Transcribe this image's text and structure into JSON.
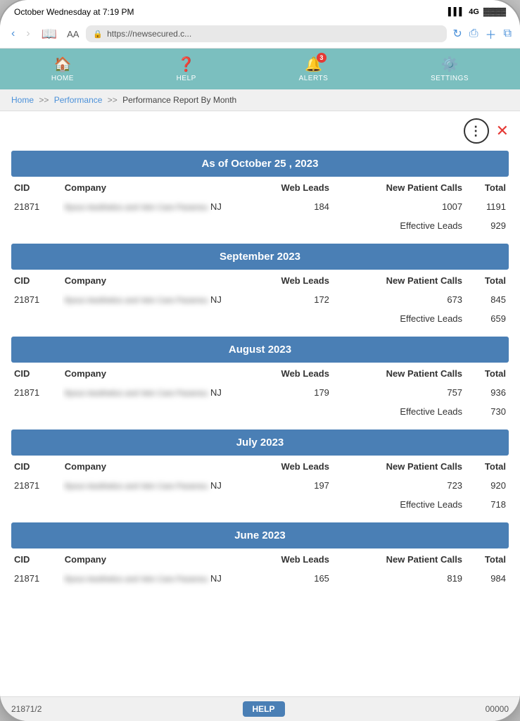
{
  "device": {
    "status_bar": {
      "time": "October Wednesday at 7:19 PM",
      "signal": "4G",
      "battery": "█"
    }
  },
  "browser": {
    "url": "https://newsecured.c...",
    "aa_label": "AA",
    "back_enabled": true,
    "forward_enabled": false
  },
  "nav": {
    "home_label": "HOME",
    "help_label": "HELP",
    "alerts_label": "ALERTS",
    "alerts_badge": "3",
    "settings_label": "SETTINGS"
  },
  "breadcrumb": {
    "home": "Home",
    "performance": "Performance",
    "current": "Performance Report By Month"
  },
  "sections": [
    {
      "id": "oct2023",
      "header": "As of October 25 , 2023",
      "rows": [
        {
          "cid": "21871",
          "company": "Ifyoun Aesthetics and Vein Care Paramou",
          "state": "NJ",
          "web_leads": "184",
          "new_patient_calls": "1007",
          "total": "1191"
        }
      ],
      "effective_leads": "929"
    },
    {
      "id": "sep2023",
      "header": "September 2023",
      "rows": [
        {
          "cid": "21871",
          "company": "Ifyoun Aesthetics and Vein Care Paramou",
          "state": "NJ",
          "web_leads": "172",
          "new_patient_calls": "673",
          "total": "845"
        }
      ],
      "effective_leads": "659"
    },
    {
      "id": "aug2023",
      "header": "August 2023",
      "rows": [
        {
          "cid": "21871",
          "company": "Ifyoun Aesthetics and Vein Care Paramou",
          "state": "NJ",
          "web_leads": "179",
          "new_patient_calls": "757",
          "total": "936"
        }
      ],
      "effective_leads": "730"
    },
    {
      "id": "jul2023",
      "header": "July 2023",
      "rows": [
        {
          "cid": "21871",
          "company": "Ifyoun Aesthetics and Vein Care Paramou",
          "state": "NJ",
          "web_leads": "197",
          "new_patient_calls": "723",
          "total": "920"
        }
      ],
      "effective_leads": "718"
    },
    {
      "id": "jun2023",
      "header": "June 2023",
      "rows": [
        {
          "cid": "21871",
          "company": "Ifyoun Aesthetics and Vein Care Paramou",
          "state": "NJ",
          "web_leads": "165",
          "new_patient_calls": "819",
          "total": "984"
        }
      ],
      "effective_leads": null
    }
  ],
  "table_headers": {
    "cid": "CID",
    "company": "Company",
    "web_leads": "Web Leads",
    "new_patient_calls": "New Patient Calls",
    "total": "Total"
  },
  "effective_leads_label": "Effective Leads",
  "footer": {
    "left": "21871/2",
    "help": "HELP",
    "right": "00000"
  },
  "dots_btn_symbol": "⋮",
  "close_btn_symbol": "✕"
}
